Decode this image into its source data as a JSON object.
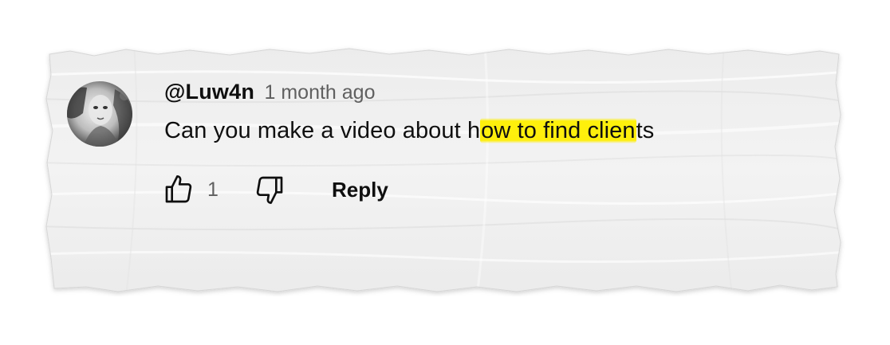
{
  "comment": {
    "author": "@Luw4n",
    "time": "1 month ago",
    "text_before": "Can you make a video about h",
    "text_highlight": "ow to find clien",
    "text_after": "ts",
    "like_count": "1",
    "reply_label": "Reply"
  },
  "icons": {
    "like": "thumbs-up-icon",
    "dislike": "thumbs-down-icon"
  },
  "colors": {
    "highlight": "#FFEE00",
    "author_text": "#0F0F0F",
    "meta_text": "#606060",
    "paper": "#F2F2F2"
  }
}
